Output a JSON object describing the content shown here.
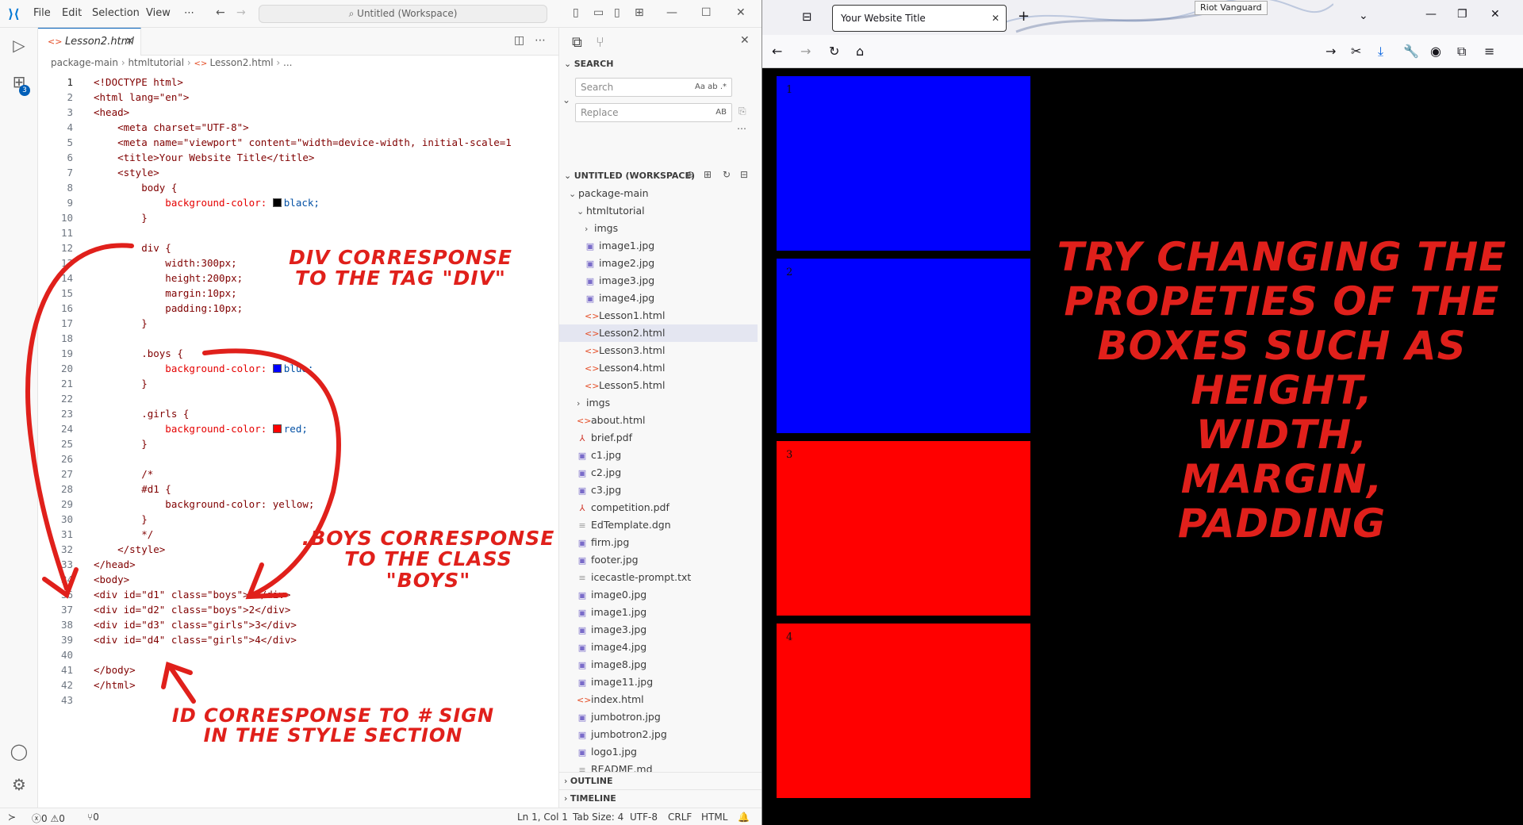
{
  "vscode": {
    "menu": [
      "File",
      "Edit",
      "Selection",
      "View",
      "⋯"
    ],
    "command_center": "Untitled (Workspace)",
    "extensions_badge": "3",
    "tab": {
      "label": "Lesson2.html"
    },
    "breadcrumb": [
      "package-main",
      "htmltutorial",
      "Lesson2.html",
      "..."
    ],
    "lines": [
      {
        "n": "1",
        "t": "<!DOCTYPE html>"
      },
      {
        "n": "2",
        "t": "<html lang=\"en\">"
      },
      {
        "n": "3",
        "t": "<head>"
      },
      {
        "n": "4",
        "t": "    <meta charset=\"UTF-8\">"
      },
      {
        "n": "5",
        "t": "    <meta name=\"viewport\" content=\"width=device-width, initial-scale=1"
      },
      {
        "n": "6",
        "t": "    <title>Your Website Title</title>"
      },
      {
        "n": "7",
        "t": "    <style>"
      },
      {
        "n": "8",
        "t": "        body {"
      },
      {
        "n": "9",
        "t": "            background-color: ",
        "swatch": "#000000",
        "t2": "black;"
      },
      {
        "n": "10",
        "t": "        }"
      },
      {
        "n": "11",
        "t": ""
      },
      {
        "n": "12",
        "t": "        div {"
      },
      {
        "n": "13",
        "t": "            width:300px;"
      },
      {
        "n": "14",
        "t": "            height:200px;"
      },
      {
        "n": "15",
        "t": "            margin:10px;"
      },
      {
        "n": "16",
        "t": "            padding:10px;"
      },
      {
        "n": "17",
        "t": "        }"
      },
      {
        "n": "18",
        "t": ""
      },
      {
        "n": "19",
        "t": "        .boys {"
      },
      {
        "n": "20",
        "t": "            background-color: ",
        "swatch": "#0000ff",
        "t2": "blue;"
      },
      {
        "n": "21",
        "t": "        }"
      },
      {
        "n": "22",
        "t": ""
      },
      {
        "n": "23",
        "t": "        .girls {"
      },
      {
        "n": "24",
        "t": "            background-color: ",
        "swatch": "#ff0000",
        "t2": "red;"
      },
      {
        "n": "25",
        "t": "        }"
      },
      {
        "n": "26",
        "t": ""
      },
      {
        "n": "27",
        "t": "        /*"
      },
      {
        "n": "28",
        "t": "        #d1 {"
      },
      {
        "n": "29",
        "t": "            background-color: yellow;"
      },
      {
        "n": "30",
        "t": "        }"
      },
      {
        "n": "31",
        "t": "        */"
      },
      {
        "n": "32",
        "t": "    </style>"
      },
      {
        "n": "33",
        "t": "</head>"
      },
      {
        "n": "34",
        "t": "<body>"
      },
      {
        "n": "36",
        "t": "<div id=\"d1\" class=\"boys\">1</div>"
      },
      {
        "n": "37",
        "t": "<div id=\"d2\" class=\"boys\">2</div>"
      },
      {
        "n": "38",
        "t": "<div id=\"d3\" class=\"girls\">3</div>"
      },
      {
        "n": "39",
        "t": "<div id=\"d4\" class=\"girls\">4</div>"
      },
      {
        "n": "40",
        "t": ""
      },
      {
        "n": "41",
        "t": "</body>"
      },
      {
        "n": "42",
        "t": "</html>"
      },
      {
        "n": "43",
        "t": ""
      }
    ],
    "sidebar": {
      "search_title": "SEARCH",
      "search_placeholder": "Search",
      "replace_placeholder": "Replace",
      "search_opts": "Aa  ab  .*",
      "replace_opts": "AB",
      "workspace_title": "UNTITLED (WORKSPACE)",
      "outline": "OUTLINE",
      "timeline": "TIMELINE",
      "tree": [
        {
          "label": "package-main",
          "kind": "folder-open",
          "depth": 0
        },
        {
          "label": "htmltutorial",
          "kind": "folder-open",
          "depth": 1
        },
        {
          "label": "imgs",
          "kind": "folder",
          "depth": 2
        },
        {
          "label": "image1.jpg",
          "kind": "img",
          "depth": 2
        },
        {
          "label": "image2.jpg",
          "kind": "img",
          "depth": 2
        },
        {
          "label": "image3.jpg",
          "kind": "img",
          "depth": 2
        },
        {
          "label": "image4.jpg",
          "kind": "img",
          "depth": 2
        },
        {
          "label": "Lesson1.html",
          "kind": "html",
          "depth": 2
        },
        {
          "label": "Lesson2.html",
          "kind": "html",
          "depth": 2,
          "selected": true
        },
        {
          "label": "Lesson3.html",
          "kind": "html",
          "depth": 2
        },
        {
          "label": "Lesson4.html",
          "kind": "html",
          "depth": 2
        },
        {
          "label": "Lesson5.html",
          "kind": "html",
          "depth": 2
        },
        {
          "label": "imgs",
          "kind": "folder",
          "depth": 1
        },
        {
          "label": "about.html",
          "kind": "html",
          "depth": 1
        },
        {
          "label": "brief.pdf",
          "kind": "pdf",
          "depth": 1
        },
        {
          "label": "c1.jpg",
          "kind": "img",
          "depth": 1
        },
        {
          "label": "c2.jpg",
          "kind": "img",
          "depth": 1
        },
        {
          "label": "c3.jpg",
          "kind": "img",
          "depth": 1
        },
        {
          "label": "competition.pdf",
          "kind": "pdf",
          "depth": 1
        },
        {
          "label": "EdTemplate.dgn",
          "kind": "file",
          "depth": 1
        },
        {
          "label": "firm.jpg",
          "kind": "img",
          "depth": 1
        },
        {
          "label": "footer.jpg",
          "kind": "img",
          "depth": 1
        },
        {
          "label": "icecastle-prompt.txt",
          "kind": "file",
          "depth": 1
        },
        {
          "label": "image0.jpg",
          "kind": "img",
          "depth": 1
        },
        {
          "label": "image1.jpg",
          "kind": "img",
          "depth": 1
        },
        {
          "label": "image3.jpg",
          "kind": "img",
          "depth": 1
        },
        {
          "label": "image4.jpg",
          "kind": "img",
          "depth": 1
        },
        {
          "label": "image8.jpg",
          "kind": "img",
          "depth": 1
        },
        {
          "label": "image11.jpg",
          "kind": "img",
          "depth": 1
        },
        {
          "label": "index.html",
          "kind": "html",
          "depth": 1
        },
        {
          "label": "jumbotron.jpg",
          "kind": "img",
          "depth": 1
        },
        {
          "label": "jumbotron2.jpg",
          "kind": "img",
          "depth": 1
        },
        {
          "label": "logo1.jpg",
          "kind": "img",
          "depth": 1
        },
        {
          "label": "README.md",
          "kind": "file",
          "depth": 1
        }
      ]
    },
    "status": {
      "errors": "0",
      "warnings": "0",
      "ports": "0",
      "cursor": "Ln 1, Col 1",
      "tab_size": "Tab Size: 4",
      "encoding": "UTF-8",
      "eol": "CRLF",
      "language": "HTML"
    },
    "annotations": {
      "div": "DIV CORRESPONSE\nTO THE TAG \"DIV\"",
      "boys": ".BOYS CORRESPONSE\nTO THE CLASS \"BOYS\"",
      "id": "ID CORRESPONSE TO # SIGN\nIN THE STYLE SECTION"
    }
  },
  "browser": {
    "tab_title": "Your Website Title",
    "tooltip": "Riot Vanguard",
    "boxes": [
      {
        "label": "1",
        "color": "blue"
      },
      {
        "label": "2",
        "color": "blue"
      },
      {
        "label": "3",
        "color": "red"
      },
      {
        "label": "4",
        "color": "red"
      }
    ],
    "annotation": "TRY CHANGING THE\nPROPETIES OF THE\nBOXES SUCH AS\nHEIGHT,\nWIDTH,\nMARGIN,\nPADDING"
  },
  "colors": {
    "accent": "#005fb8",
    "annotation_red": "#e0201b",
    "box_blue": "#0000ff",
    "box_red": "#ff0000"
  }
}
